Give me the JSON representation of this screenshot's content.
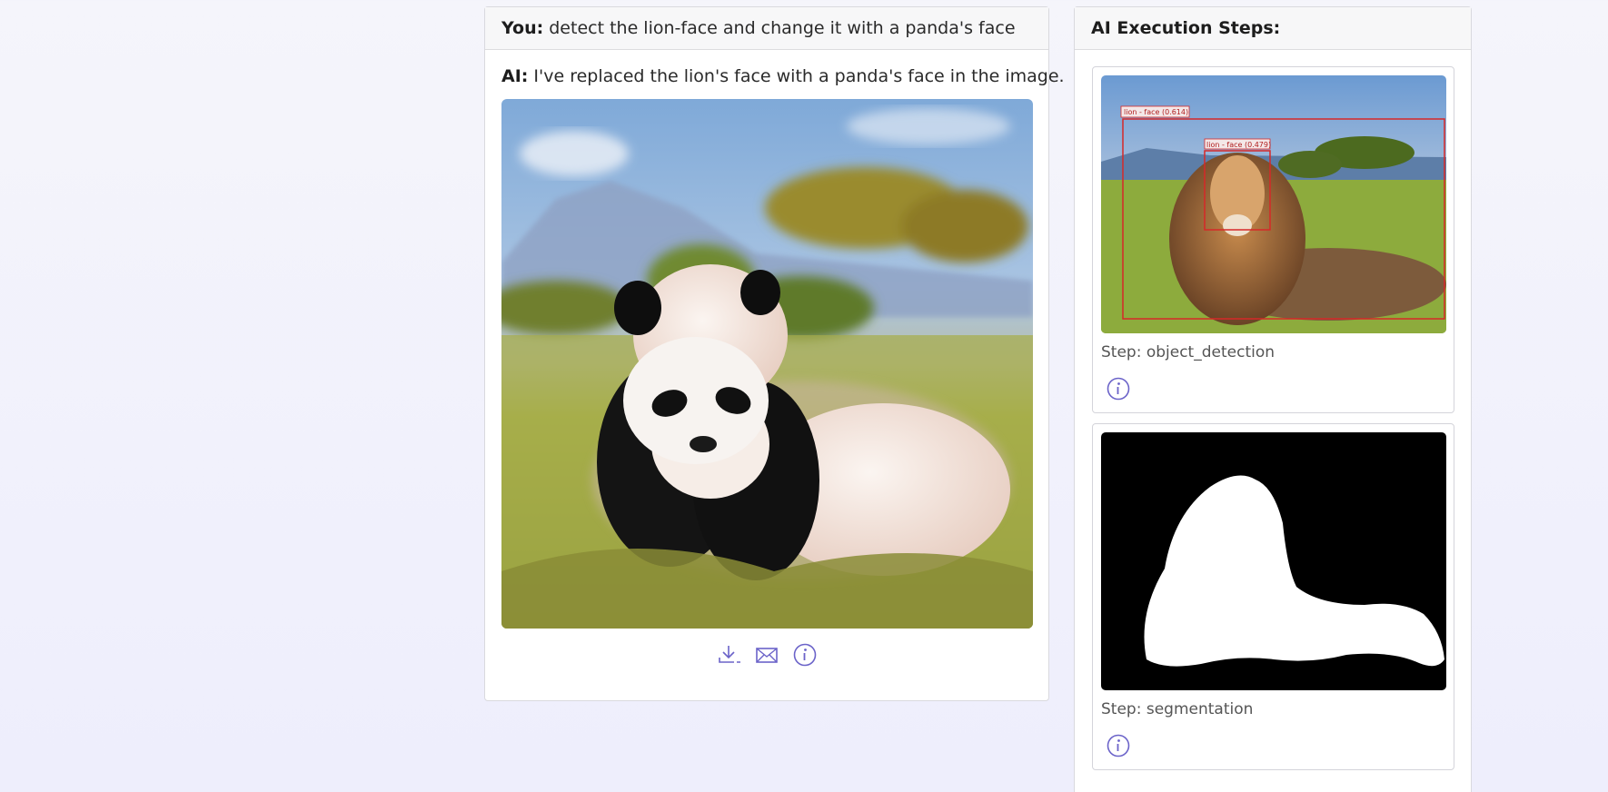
{
  "chat": {
    "user_prefix": "You:",
    "user_message": "detect the lion-face and change it with a panda's face",
    "ai_prefix": "AI:",
    "ai_message": "I've replaced the lion's face with a panda's face in the image."
  },
  "actions": {
    "icons": [
      "download-icon",
      "mail-icon",
      "info-icon"
    ],
    "accent_color": "#6b63c9"
  },
  "steps_panel": {
    "title": "AI Execution Steps:",
    "steps": [
      {
        "label": "Step: object_detection",
        "detections": [
          "lion - face (0.614)",
          "lion - face (0.479)"
        ]
      },
      {
        "label": "Step: segmentation"
      }
    ]
  }
}
